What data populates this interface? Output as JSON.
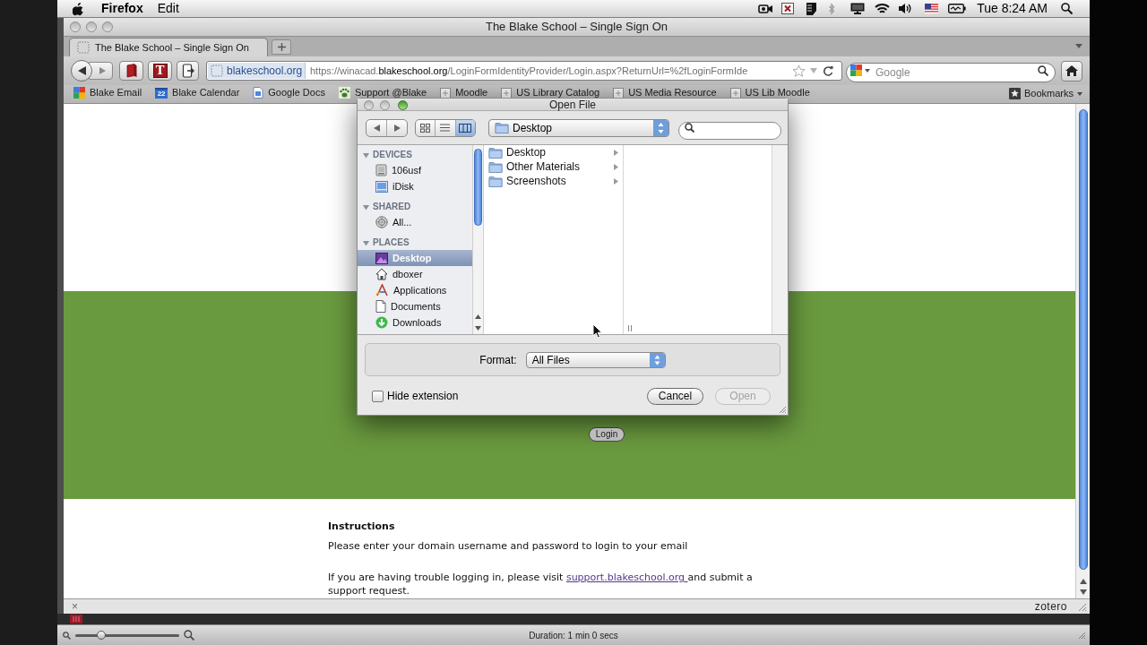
{
  "menu_bar": {
    "app": "Firefox",
    "menus": [
      "Edit"
    ],
    "clock": "Tue 8:24 AM"
  },
  "window": {
    "title": "The Blake School – Single Sign On"
  },
  "tabs": [
    {
      "label": "The Blake School – Single Sign On",
      "selected": true
    }
  ],
  "nav_bar": {
    "toolbar_buttons": [
      {
        "kind": "book"
      },
      {
        "kind": "letter",
        "text": "T"
      },
      {
        "kind": "export"
      }
    ],
    "site_identity": "blakeschool.org",
    "url": {
      "scheme": "https://winacad.",
      "domain": "blakeschool.org",
      "path": "/LoginFormIdentityProvider/Login.aspx?ReturnUrl=%2fLoginFormIde"
    },
    "search": {
      "placeholder": "Google"
    }
  },
  "bookmarks": {
    "items": [
      {
        "label": "Blake Email",
        "kind": "google"
      },
      {
        "label": "Blake Calendar",
        "kind": "calendar",
        "icon_text": "22"
      },
      {
        "label": "Google Docs",
        "kind": "docs"
      },
      {
        "label": "Support @Blake",
        "kind": "paw"
      },
      {
        "label": "Moodle",
        "kind": "page"
      },
      {
        "label": "US Library Catalog",
        "kind": "page"
      },
      {
        "label": "US Media Resource",
        "kind": "page"
      },
      {
        "label": "US Lib Moodle",
        "kind": "page"
      }
    ],
    "menu": "Bookmarks"
  },
  "page": {
    "login_button": "Login",
    "instructions": {
      "title": "Instructions",
      "text": "Please enter your domain username and password to login to your email",
      "help": {
        "before": "If you are having trouble logging in, please visit",
        "link": "support.blakeschool.org",
        "after": "and submit a support request."
      }
    }
  },
  "addon_bar": {
    "close": "×",
    "logo_text": "zotero"
  },
  "recorder": {
    "zoom": {
      "level": 0.25
    },
    "duration": "Duration: 1 min 0 secs"
  },
  "dialog": {
    "title": "Open File",
    "view_modes": [
      {
        "kind": "icons",
        "selected": false
      },
      {
        "kind": "list",
        "selected": false
      },
      {
        "kind": "columns",
        "selected": true
      }
    ],
    "location": "Desktop",
    "sidebar": [
      {
        "heading": "DEVICES",
        "expanded": true,
        "items": [
          {
            "label": "106usf",
            "kind": "drive",
            "selected": false
          },
          {
            "label": "iDisk",
            "kind": "idisk",
            "selected": false
          }
        ]
      },
      {
        "heading": "SHARED",
        "expanded": true,
        "items": [
          {
            "label": "All...",
            "kind": "network",
            "selected": false
          }
        ]
      },
      {
        "heading": "PLACES",
        "expanded": true,
        "items": [
          {
            "label": "Desktop",
            "kind": "desktop",
            "selected": true
          },
          {
            "label": "dboxer",
            "kind": "home",
            "selected": false
          },
          {
            "label": "Applications",
            "kind": "applications",
            "selected": false
          },
          {
            "label": "Documents",
            "kind": "documents",
            "selected": false
          },
          {
            "label": "Downloads",
            "kind": "downloads",
            "selected": false
          }
        ]
      }
    ],
    "columns": [
      {
        "items": [
          {
            "label": "Desktop",
            "selected": false
          },
          {
            "label": "Other Materials",
            "selected": false
          },
          {
            "label": "Screenshots",
            "selected": false
          }
        ]
      }
    ],
    "format": {
      "label": "Format:",
      "value": "All Files"
    },
    "hide_extension": {
      "label": "Hide extension",
      "checked": false
    },
    "buttons": [
      {
        "label": "Cancel",
        "disabled": false
      },
      {
        "label": "Open",
        "disabled": true
      }
    ]
  }
}
